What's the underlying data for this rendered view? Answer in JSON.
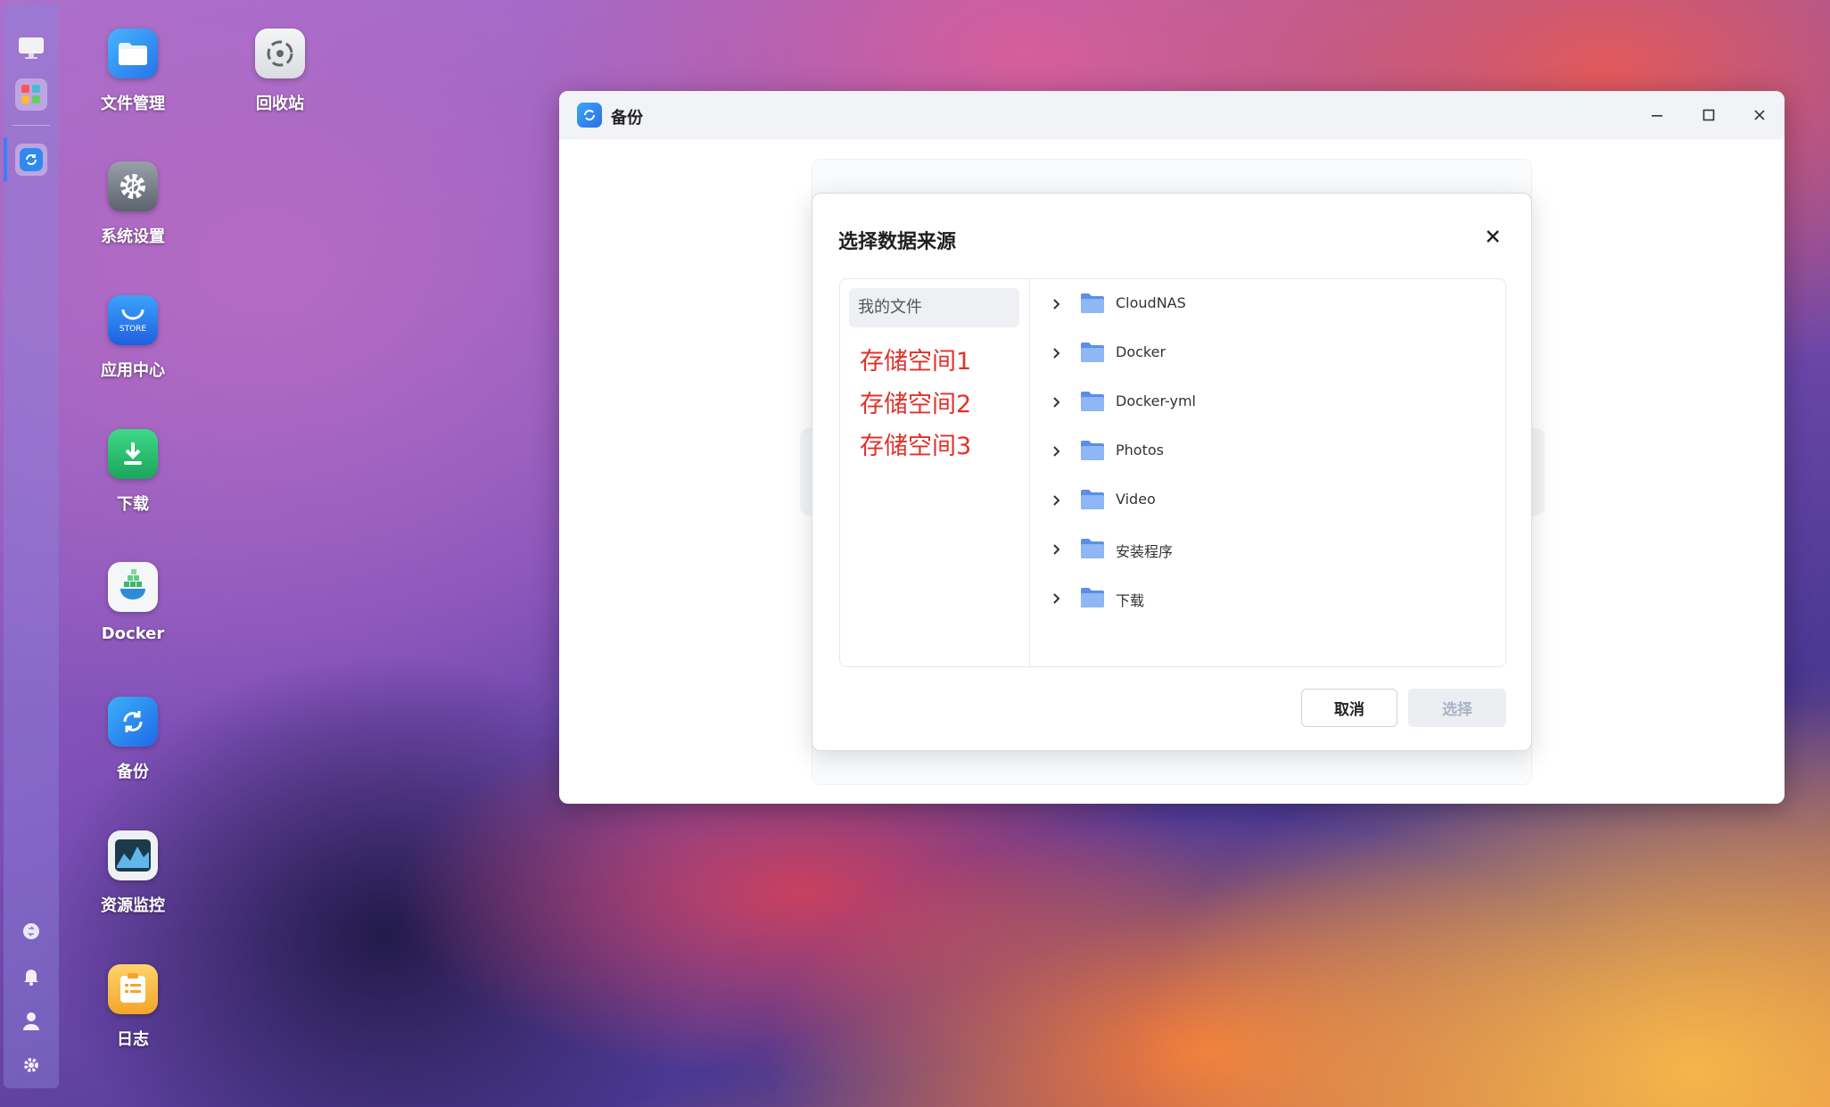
{
  "desktop": {
    "icons": [
      {
        "label": "文件管理",
        "icon": "folder-manager-icon"
      },
      {
        "label": "回收站",
        "icon": "recycle-bin-icon"
      },
      {
        "label": "系统设置",
        "icon": "gear-icon"
      },
      {
        "label": "应用中心",
        "icon": "store-bag-icon",
        "badge": "STORE"
      },
      {
        "label": "下载",
        "icon": "download-icon"
      },
      {
        "label": "Docker",
        "icon": "docker-icon"
      },
      {
        "label": "备份",
        "icon": "backup-sync-icon"
      },
      {
        "label": "资源监控",
        "icon": "resource-monitor-icon"
      },
      {
        "label": "日志",
        "icon": "log-icon"
      }
    ]
  },
  "sidebar": {
    "items": [
      "monitor-icon",
      "apps-grid-icon",
      "backup-sync-icon"
    ],
    "bottom": [
      "switch-icon",
      "bell-icon",
      "user-icon",
      "gear-icon"
    ]
  },
  "window": {
    "title": "备份",
    "controls": [
      "minimize-icon",
      "maximize-icon",
      "close-icon"
    ]
  },
  "dialog": {
    "title": "选择数据来源",
    "sources": [
      {
        "label": "我的文件",
        "selected": true
      }
    ],
    "annotations": [
      "存储空间1",
      "存储空间2",
      "存储空间3"
    ],
    "annotation_color": "#e1312a",
    "folders": [
      "CloudNAS",
      "Docker",
      "Docker-yml",
      "Photos",
      "Video",
      "安装程序",
      "下载"
    ],
    "cancel_label": "取消",
    "select_label": "选择"
  },
  "colors": {
    "accent": "#2f6be8",
    "folder": "#6a9cf0"
  }
}
